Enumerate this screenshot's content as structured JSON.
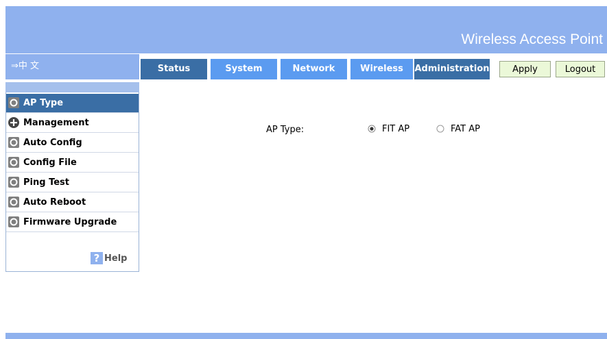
{
  "header": {
    "title": "Wireless Access Point"
  },
  "language": {
    "label": "⇒中 文"
  },
  "nav": {
    "tabs": [
      "Status",
      "System",
      "Network",
      "Wireless",
      "Administration"
    ],
    "apply_label": "Apply",
    "logout_label": "Logout"
  },
  "sidebar": {
    "items": [
      {
        "label": "AP Type",
        "icon": "circle-icon",
        "active": true
      },
      {
        "label": "Management",
        "icon": "plus-icon"
      },
      {
        "label": "Auto Config",
        "icon": "circle-icon"
      },
      {
        "label": "Config File",
        "icon": "circle-icon"
      },
      {
        "label": "Ping Test",
        "icon": "circle-icon"
      },
      {
        "label": "Auto Reboot",
        "icon": "circle-icon"
      },
      {
        "label": "Firmware Upgrade",
        "icon": "circle-icon"
      }
    ],
    "help": {
      "glyph": "?",
      "label": "Help"
    }
  },
  "main": {
    "ap_type_label": "AP Type:",
    "options": [
      {
        "label": "FIT AP",
        "checked": true
      },
      {
        "label": "FAT AP",
        "checked": false
      }
    ]
  },
  "colors": {
    "banner": "#8fb1ee",
    "tab_dark": "#3a6ea5",
    "tab_light": "#5b9bf0",
    "button_bg": "#ebf8d8"
  }
}
